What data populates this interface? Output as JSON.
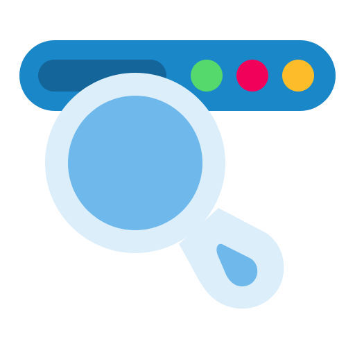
{
  "icon": {
    "name": "web-search-icon",
    "colors": {
      "background": "#ffffff",
      "browser_bar": "#1a87c9",
      "address_field": "#14659a",
      "dot_green": "#56d96c",
      "dot_red": "#f2015a",
      "dot_yellow": "#fdbd2b",
      "lens_frame": "#dbeefa",
      "lens_glass": "#6eb8ec",
      "handle_grip": "#6eb8ec"
    },
    "parts": [
      "browser-bar",
      "address-field",
      "window-dot-green",
      "window-dot-red",
      "window-dot-yellow",
      "magnifier-frame",
      "magnifier-lens",
      "magnifier-handle-grip"
    ]
  }
}
